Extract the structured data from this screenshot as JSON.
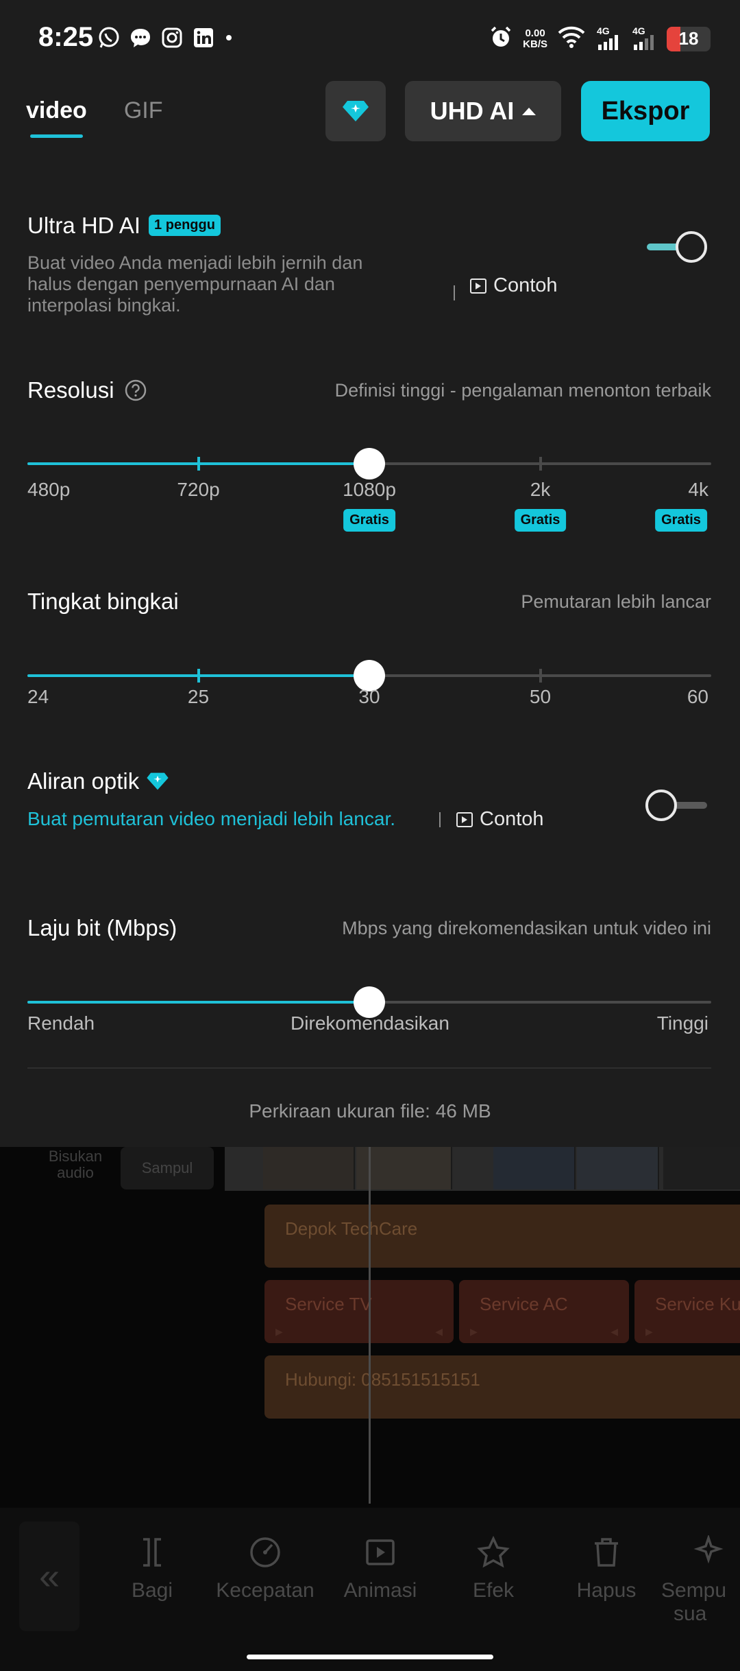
{
  "status_bar": {
    "time": "8:25",
    "net_speed_value": "0.00",
    "net_speed_unit": "KB/S",
    "sim1": "4G",
    "sim2": "4G",
    "battery": "18"
  },
  "header": {
    "tabs": [
      {
        "label": "video"
      },
      {
        "label": "GIF"
      }
    ],
    "quality_button": "UHD AI",
    "export_button": "Ekspor"
  },
  "ultra_hd": {
    "title": "Ultra HD AI",
    "badge": "1 penggu",
    "description": "Buat video Anda menjadi lebih jernih dan halus dengan penyempurnaan AI dan interpolasi bingkai.",
    "example": "Contoh",
    "enabled": true
  },
  "resolution": {
    "title": "Resolusi",
    "hint": "Definisi tinggi - pengalaman menonton terbaik",
    "options": [
      "480p",
      "720p",
      "1080p",
      "2k",
      "4k"
    ],
    "selected_index": 2,
    "badges": {
      "1080p": "Gratis",
      "2k": "Gratis",
      "4k": "Gratis"
    }
  },
  "frame_rate": {
    "title": "Tingkat bingkai",
    "hint": "Pemutaran lebih lancar",
    "options": [
      "24",
      "25",
      "30",
      "50",
      "60"
    ],
    "selected_index": 2
  },
  "optical_flow": {
    "title": "Aliran optik",
    "subtitle": "Buat pemutaran video menjadi lebih lancar.",
    "example": "Contoh",
    "enabled": false
  },
  "bitrate": {
    "title": "Laju bit (Mbps)",
    "hint": "Mbps yang direkomendasikan untuk video ini",
    "labels": [
      "Rendah",
      "Direkomendasikan",
      "Tinggi"
    ],
    "value_fraction": 0.5
  },
  "file_size": "Perkiraan ukuran file: 46 MB",
  "timeline": {
    "side_label_1": "Bisukan",
    "side_label_2": "audio",
    "cover_label": "Sampul",
    "text_clip_1": "Depok TechCare",
    "clips": [
      "Service TV",
      "Service AC",
      "Service Ku"
    ],
    "text_clip_2": "Hubungi: 085151515151"
  },
  "toolbar": {
    "items": [
      {
        "label": "Bagi",
        "icon": "split-icon"
      },
      {
        "label": "Kecepatan",
        "icon": "speed-icon"
      },
      {
        "label": "Animasi",
        "icon": "animation-icon"
      },
      {
        "label": "Efek",
        "icon": "effects-icon"
      },
      {
        "label": "Hapus",
        "icon": "delete-icon"
      },
      {
        "label": "Sempu",
        "icon": "sparkle-icon"
      }
    ],
    "last_label_line2": "sua"
  },
  "colors": {
    "accent": "#14c7dc",
    "sheet_bg": "#1d1d1d",
    "battery_low": "#e5433c"
  }
}
